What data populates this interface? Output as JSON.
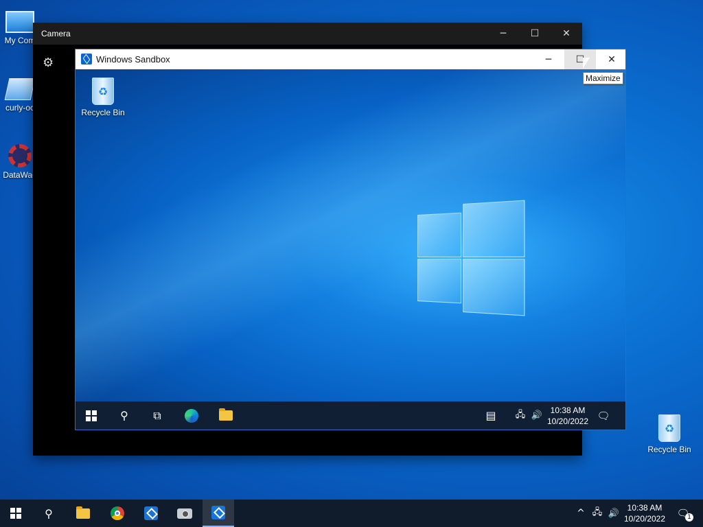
{
  "host_desktop": {
    "icons": [
      {
        "label": "My Com",
        "icon": "computer-icon"
      },
      {
        "label": "curly-oc",
        "icon": "book-icon"
      },
      {
        "label": "DataWag",
        "icon": "app-shortcut-icon"
      },
      {
        "label": "Recycle Bin",
        "icon": "recycle-bin-icon"
      }
    ]
  },
  "camera_window": {
    "title": "Camera",
    "minimize_glyph": "─",
    "maximize_glyph": "☐",
    "close_glyph": "✕",
    "settings_glyph": "⚙"
  },
  "sandbox_window": {
    "title": "Windows Sandbox",
    "minimize_glyph": "─",
    "maximize_glyph": "☐",
    "close_glyph": "✕",
    "tooltip": "Maximize",
    "desktop_icons": [
      {
        "label": "Recycle Bin",
        "icon": "recycle-bin-icon"
      }
    ],
    "taskbar": {
      "search_glyph": "⚲",
      "taskview_glyph": "⧉",
      "news_glyph": "▤",
      "network_glyph": "🖧",
      "volume_glyph": "🔊",
      "notification_glyph": "🗨",
      "time": "10:38 AM",
      "date": "10/20/2022"
    }
  },
  "host_taskbar": {
    "search_glyph": "⚲",
    "tray_chevron_glyph": "^",
    "network_glyph": "🖧",
    "volume_glyph": "🔊",
    "notification_glyph": "🗨",
    "notification_count": "1",
    "time": "10:38 AM",
    "date": "10/20/2022"
  },
  "colors": {
    "desktop_blue": "#0a6fd1",
    "taskbar": "#101c2c",
    "accent": "#1a74d6"
  }
}
